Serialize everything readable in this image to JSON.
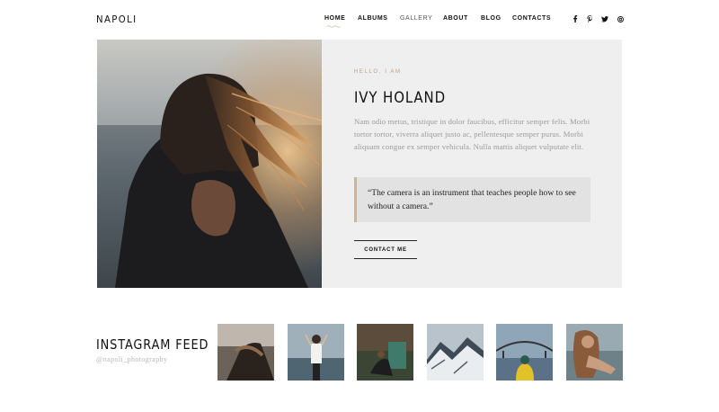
{
  "header": {
    "logo": "NAPOLI",
    "nav": [
      {
        "label": "HOME",
        "active": true
      },
      {
        "label": "ALBUMS"
      },
      {
        "label": "GALLERY"
      },
      {
        "label": "ABOUT"
      },
      {
        "label": "BLOG"
      },
      {
        "label": "CONTACTS"
      }
    ],
    "social": [
      {
        "icon": "facebook-icon",
        "glyph": "f"
      },
      {
        "icon": "pinterest-icon",
        "glyph": "p"
      },
      {
        "icon": "twitter-icon",
        "glyph": "t"
      },
      {
        "icon": "instagram-icon",
        "glyph": "◎"
      }
    ]
  },
  "hero": {
    "eyebrow": "HELLO, I AM",
    "name": "IVY HOLAND",
    "bio": "Nam odio metus, tristique in dolor faucibus, efficitur semper felis. Morbi tortor tortor, viverra aliquet justo ac, pellentesque semper purus. Morbi aliquam congue ex semper vehicula. Nulla mattis aliquet vulputate elit.",
    "quote": "“The camera is an instrument that teaches people how to see without a camera.”",
    "button": "CONTACT ME"
  },
  "instagram": {
    "title": "INSTAGRAM FEED",
    "handle": "@napoli_photography"
  },
  "colors": {
    "accent": "#c8b79a",
    "hero_bg": "#efefef",
    "quote_bg": "#e2e2e2"
  }
}
